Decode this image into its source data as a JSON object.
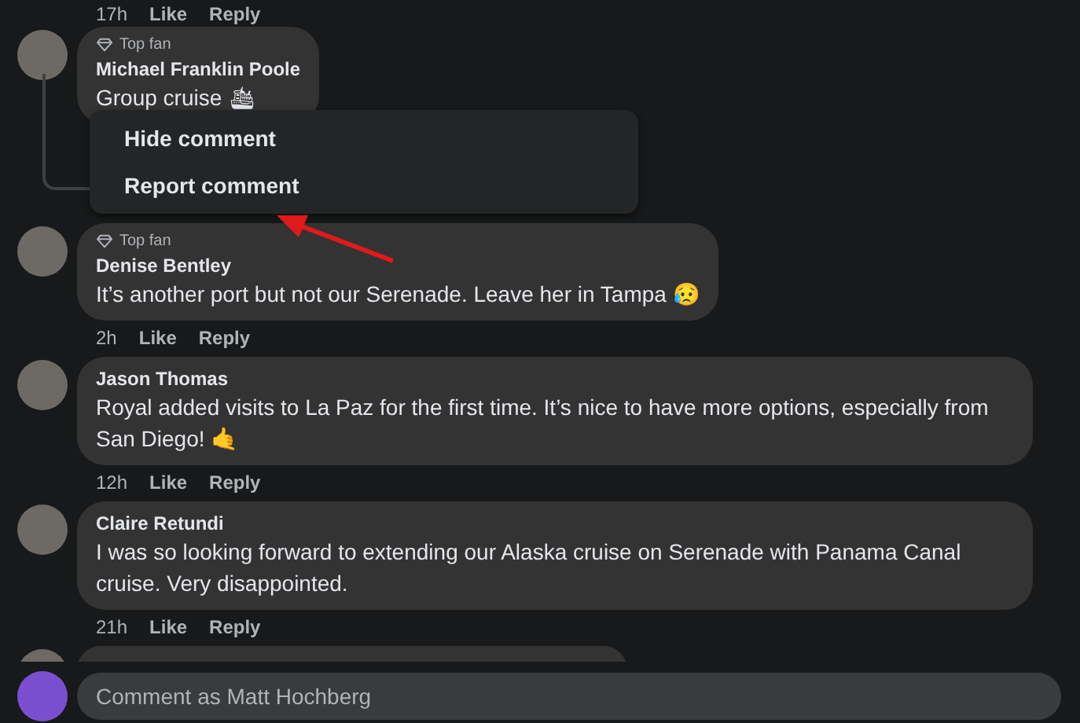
{
  "top_actions": {
    "time": "17h",
    "like": "Like",
    "reply": "Reply"
  },
  "comments": [
    {
      "author": "Michael Franklin Poole",
      "badge": "Top fan",
      "text": "Group cruise 🛳"
    },
    {
      "author": "Denise Bentley",
      "badge": "Top fan",
      "text": "It’s another port but not our Serenade. Leave her in Tampa 😥",
      "actions": {
        "time": "2h",
        "like": "Like",
        "reply": "Reply"
      }
    },
    {
      "author": "Jason Thomas",
      "text": "Royal added visits to La Paz for the first time. It’s nice to have more options, especially from San Diego! 🤙",
      "actions": {
        "time": "12h",
        "like": "Like",
        "reply": "Reply"
      }
    },
    {
      "author": "Claire Retundi",
      "text": "I was so looking forward to extending our Alaska cruise on Serenade with Panama Canal cruise. Very disappointed.",
      "actions": {
        "time": "21h",
        "like": "Like",
        "reply": "Reply"
      }
    }
  ],
  "context_menu": {
    "items": [
      "Hide comment",
      "Report comment"
    ]
  },
  "composer": {
    "placeholder": "Comment as Matt Hochberg"
  }
}
